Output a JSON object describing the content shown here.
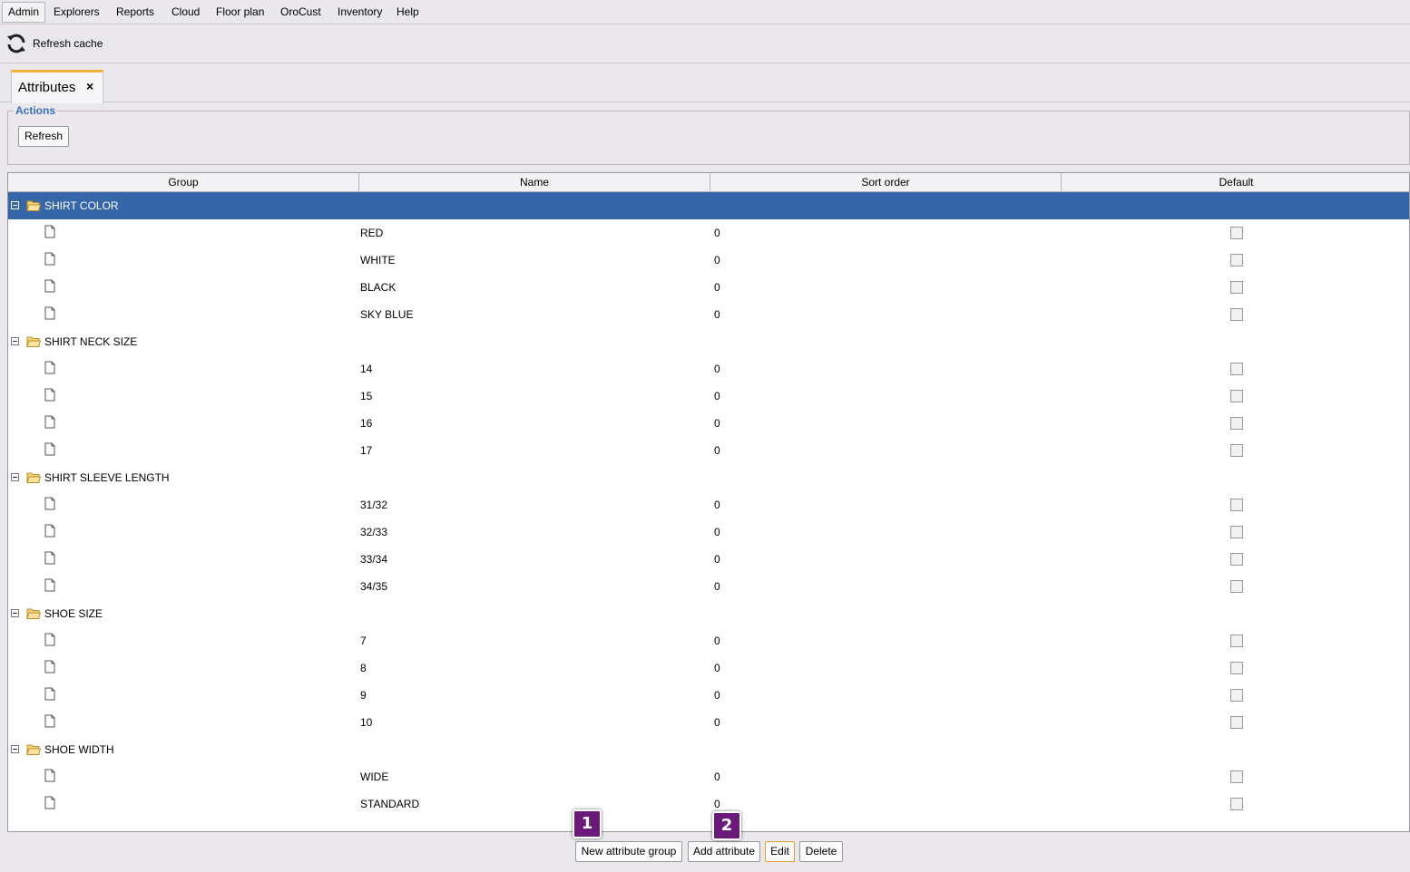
{
  "menubar": {
    "items": [
      "Admin",
      "Explorers",
      "Reports",
      "Cloud",
      "Floor plan",
      "OroCust",
      "Inventory",
      "Help"
    ]
  },
  "toolbar": {
    "refresh_cache_label": "Refresh cache",
    "refresh_icon": "refresh-icon"
  },
  "tabs": [
    {
      "label": "Attributes",
      "close": "×"
    }
  ],
  "actions": {
    "legend": "Actions",
    "refresh_label": "Refresh"
  },
  "table": {
    "headers": [
      "Group",
      "Name",
      "Sort order",
      "Default"
    ],
    "groups": [
      {
        "name": "SHIRT COLOR",
        "selected": true,
        "items": [
          {
            "name": "RED",
            "sort": "0"
          },
          {
            "name": "WHITE",
            "sort": "0"
          },
          {
            "name": "BLACK",
            "sort": "0"
          },
          {
            "name": "SKY BLUE",
            "sort": "0"
          }
        ]
      },
      {
        "name": "SHIRT NECK SIZE",
        "items": [
          {
            "name": "14",
            "sort": "0"
          },
          {
            "name": "15",
            "sort": "0"
          },
          {
            "name": "16",
            "sort": "0"
          },
          {
            "name": "17",
            "sort": "0"
          }
        ]
      },
      {
        "name": "SHIRT SLEEVE LENGTH",
        "items": [
          {
            "name": "31/32",
            "sort": "0"
          },
          {
            "name": "32/33",
            "sort": "0"
          },
          {
            "name": "33/34",
            "sort": "0"
          },
          {
            "name": "34/35",
            "sort": "0"
          }
        ]
      },
      {
        "name": "SHOE SIZE",
        "items": [
          {
            "name": "7",
            "sort": "0"
          },
          {
            "name": "8",
            "sort": "0"
          },
          {
            "name": "9",
            "sort": "0"
          },
          {
            "name": "10",
            "sort": "0"
          }
        ]
      },
      {
        "name": "SHOE WIDTH",
        "items": [
          {
            "name": "WIDE",
            "sort": "0"
          },
          {
            "name": "STANDARD",
            "sort": "0"
          }
        ]
      }
    ]
  },
  "bottom": {
    "new_group_label": "New attribute group",
    "add_attribute_label": "Add attribute",
    "edit_label": "Edit",
    "delete_label": "Delete",
    "badge1": "1",
    "badge2": "2"
  },
  "colors": {
    "selection": "#3466a8",
    "accent_tab": "#f0b43c",
    "badge": "#6b1a7a",
    "legend": "#3a6db5"
  }
}
